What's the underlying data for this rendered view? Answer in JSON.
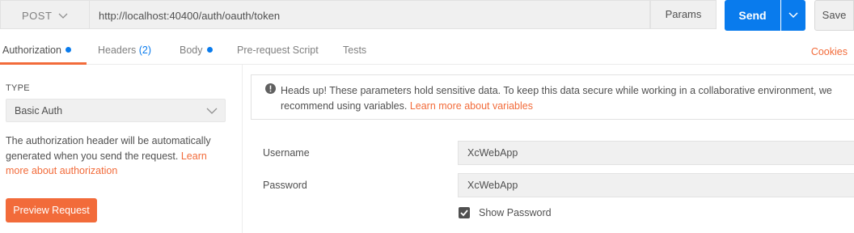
{
  "request": {
    "method": "POST",
    "url": "http://localhost:40400/auth/oauth/token",
    "params_label": "Params",
    "send_label": "Send",
    "save_label": "Save"
  },
  "tabs": [
    {
      "label": "Authorization",
      "active": true
    },
    {
      "label": "Headers",
      "count": "(2)"
    },
    {
      "label": "Body"
    },
    {
      "label": "Pre-request Script"
    },
    {
      "label": "Tests"
    }
  ],
  "cookies_label": "Cookies",
  "auth": {
    "type_label": "TYPE",
    "type_value": "Basic Auth",
    "description": "The authorization header will be automatically generated when you send the request.",
    "learn_more": "Learn more about authorization",
    "preview_label": "Preview Request"
  },
  "warning": {
    "text": "Heads up! These parameters hold sensitive data. To keep this data secure while working in a collaborative environment, we recommend using variables.",
    "link": "Learn more about variables"
  },
  "fields": {
    "username_label": "Username",
    "username_value": "XcWebApp",
    "password_label": "Password",
    "password_value": "XcWebApp",
    "show_password_label": "Show Password"
  },
  "colors": {
    "accent": "#f26b3a",
    "primary": "#097bed"
  }
}
